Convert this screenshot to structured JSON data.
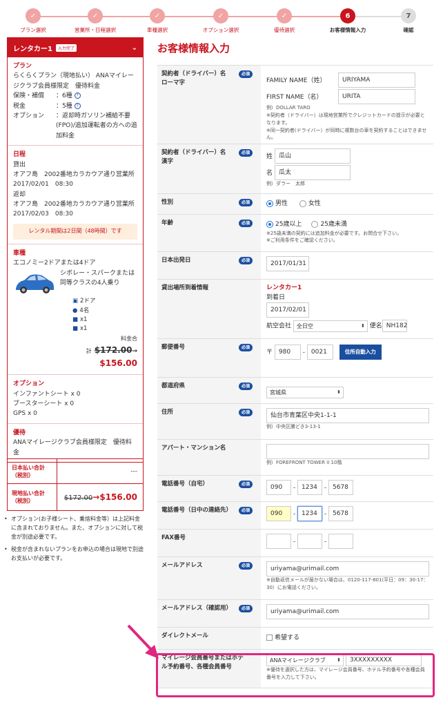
{
  "stepper": {
    "steps": [
      {
        "label": "プラン選択",
        "num": "",
        "state": "done"
      },
      {
        "label": "営業所・日程選択",
        "num": "",
        "state": "done"
      },
      {
        "label": "車種選択",
        "num": "",
        "state": "done"
      },
      {
        "label": "オプション選択",
        "num": "",
        "state": "done"
      },
      {
        "label": "優待選択",
        "num": "",
        "state": "done"
      },
      {
        "label": "お客様情報入力",
        "num": "6",
        "state": "current"
      },
      {
        "label": "確認",
        "num": "7",
        "state": "todo"
      }
    ]
  },
  "left": {
    "header": {
      "title": "レンタカー1",
      "badge": "入力完了"
    },
    "plan": {
      "heading": "プラン",
      "name": "らくらくプラン（現地払い） ANAマイレージクラブ会員様限定　優待料金",
      "insurance_key": "保険・補償",
      "insurance_val": "：6種",
      "tax_key": "税金",
      "tax_val": "：5種",
      "option_key": "オプション",
      "option_val": "：返却時ガソリン補給不要(FPO)/追加運転者の方への追加料金"
    },
    "schedule": {
      "heading": "日程",
      "rent_label": "貸出",
      "rent_place": "オアフ島　2002番地カラカウア通り営業所",
      "rent_dt": "2017/02/01　08:30",
      "return_label": "返却",
      "return_place": "オアフ島　2002番地カラカウア通り営業所",
      "return_dt": "2017/02/03　08:30",
      "note": "レンタル期間は2日間（48時間）です"
    },
    "car": {
      "heading": "車種",
      "class": "エコノミー2ドアまたは4ドア",
      "model": "シボレー・スパークまたは同等クラスの4人乗り",
      "specs": [
        "2ドア",
        "4名",
        "x1",
        "x1"
      ],
      "fee_label": "料金合",
      "total_prefix": "計",
      "old": "$172.00",
      "arrow": "→",
      "new": "$156.00"
    },
    "options": {
      "heading": "オプション",
      "items": [
        "インファントシート x 0",
        "ブースターシート x 0",
        "GPS x 0"
      ]
    },
    "benefits": {
      "heading": "優待",
      "text": "ANAマイレージクラブ会員様限定　優待料金"
    },
    "totals": {
      "jp_label": "日本払い合計（税別）",
      "jp_value": "---",
      "local_label": "現地払い合計（税別）",
      "local_old": "$172.00",
      "arrow": "→",
      "local_new": "$156.00"
    },
    "notes": [
      "オプション(お子様シート、乗捨料金等）は上記料金に含まれておりません。また、オプションに対して税金が別途必要です。",
      "税金が含まれないプランをお申込の場合は現地で別途お支払いが必要です。"
    ]
  },
  "form": {
    "title": "お客様情報入力",
    "required": "必須",
    "contract_roma": {
      "label": "契約者（ドライバー）名　ローマ字",
      "last_label": "FAMILY NAME（姓）",
      "last_value": "URIYAMA",
      "first_label": "FIRST NAME（名）",
      "first_value": "URITA",
      "example": "例）DOLLAR TARO",
      "note1": "※契約者（ドライバー）は現地営業所でクレジットカードの提示が必要となります。",
      "note2": "※同一契約者(ドライバー）が同時に複数台の車を契約することはできません。"
    },
    "contract_kanji": {
      "label": "契約者（ドライバー）名　漢字",
      "sei": "姓",
      "sei_value": "瓜山",
      "mei": "名",
      "mei_value": "瓜太",
      "example": "例）ダラー　太郎"
    },
    "gender": {
      "label": "性別",
      "male": "男性",
      "female": "女性"
    },
    "age": {
      "label": "年齢",
      "over": "25歳以上",
      "under": "25歳未満",
      "note1": "※25歳未満の契約には追加料金が必要です。お問合せ下さい。",
      "note2": "※ご利用条件をご確認ください。"
    },
    "departure": {
      "label": "日本出発日",
      "value": "2017/01/31"
    },
    "arrival": {
      "label": "貸出場所到着情報",
      "car": "レンタカー1",
      "arr_label": "到着日",
      "arr_value": "2017/02/01",
      "airline_label": "航空会社",
      "airline_value": "全日空",
      "flight_label": "便名",
      "flight_value": "NH182"
    },
    "postal": {
      "label": "郵便番号",
      "mark": "〒",
      "p1": "980",
      "dash": "-",
      "p2": "0021",
      "button": "住所自動入力"
    },
    "prefecture": {
      "label": "都道府県",
      "value": "宮城県"
    },
    "address": {
      "label": "住所",
      "value": "仙台市青葉区中央1-1-1",
      "example": "例）中央区勝どき3-13-1"
    },
    "building": {
      "label": "アパート・マンション名",
      "value": "",
      "example": "例）FOREFRONT TOWER II 10階"
    },
    "home_phone": {
      "label": "電話番号（自宅）",
      "p1": "090",
      "p2": "1234",
      "p3": "5678"
    },
    "day_phone": {
      "label": "電話番号（日中の連絡先）",
      "p1": "090",
      "p2": "1234",
      "p3": "5678"
    },
    "fax": {
      "label": "FAX番号"
    },
    "email": {
      "label": "メールアドレス",
      "value": "uriyama@urimail.com",
      "note": "※自動返信メールが届かない場合は、0120-117-801(平日：09：30-17：30）にお電話ください。"
    },
    "email_confirm": {
      "label": "メールアドレス（確認用）",
      "value": "uriyama@urimail.com"
    },
    "direct_mail": {
      "label": "ダイレクトメール",
      "option": "希望する"
    },
    "mileage": {
      "label": "マイレージ会員番号またはホテル予約番号、各種会員番号",
      "select": "ANAマイレージクラブ",
      "value": "3XXXXXXXXX",
      "note": "※優待を選択した方は、マイレージ会員番号、ホテル予約番号や各種会員番号を入力して下さい。"
    }
  },
  "colors": {
    "brand": "#c9151e",
    "blue": "#1a4fa0",
    "highlight": "#e0267f"
  }
}
